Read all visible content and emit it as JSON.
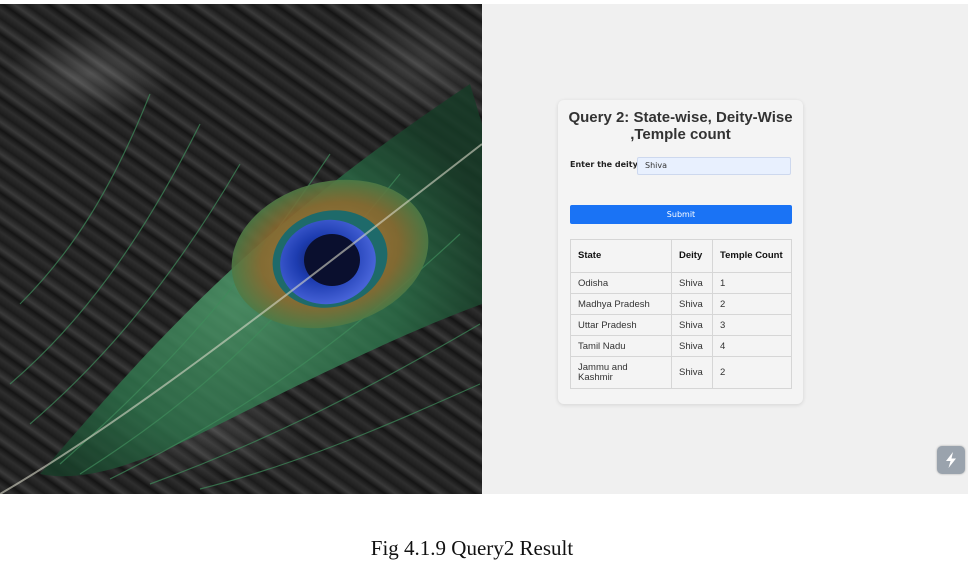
{
  "background_image": {
    "icon": "peacock-feather-image"
  },
  "form": {
    "title": "Query 2: State-wise, Deity-Wise ,Temple count",
    "deity_label": "Enter the deity:",
    "deity_value": "Shiva",
    "submit_label": "Submit",
    "submit_color": "#1a73f5"
  },
  "table": {
    "headers": [
      "State",
      "Deity",
      "Temple Count"
    ],
    "rows": [
      [
        "Odisha",
        "Shiva",
        "1"
      ],
      [
        "Madhya Pradesh",
        "Shiva",
        "2"
      ],
      [
        "Uttar Pradesh",
        "Shiva",
        "3"
      ],
      [
        "Tamil Nadu",
        "Shiva",
        "4"
      ],
      [
        "Jammu and Kashmir",
        "Shiva",
        "2"
      ]
    ]
  },
  "corner_icon": "lightning-bolt-icon",
  "caption": "Fig 4.1.9 Query2 Result"
}
